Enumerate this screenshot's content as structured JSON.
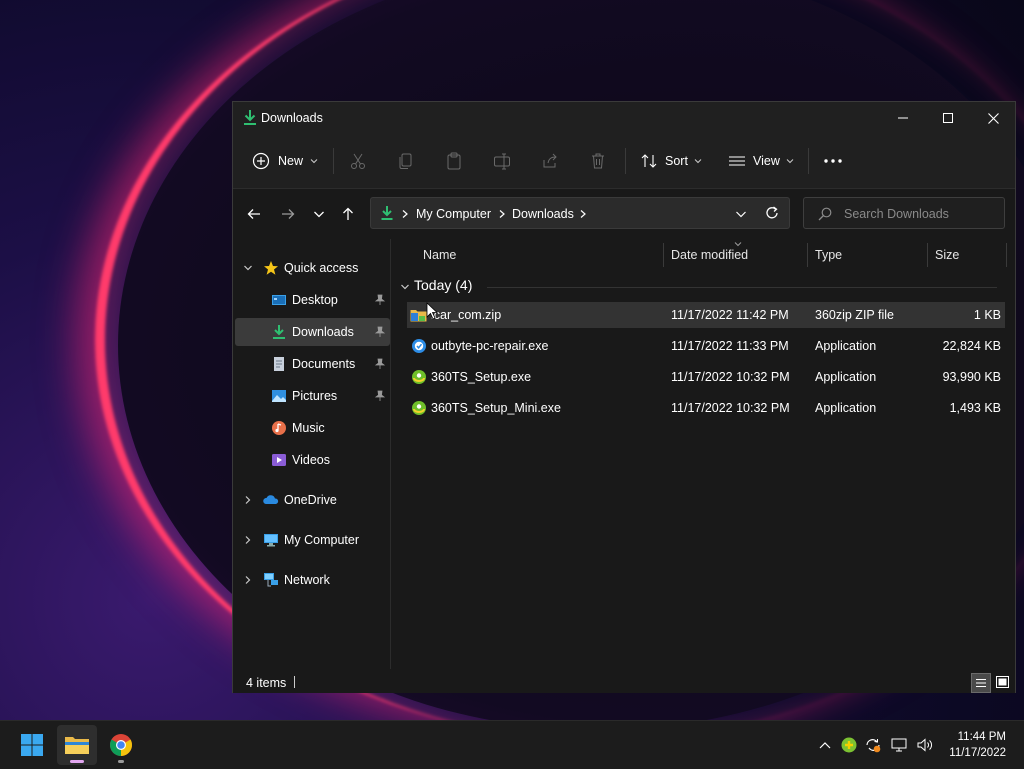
{
  "window": {
    "title": "Downloads"
  },
  "toolbar": {
    "new_label": "New",
    "sort_label": "Sort",
    "view_label": "View"
  },
  "address": {
    "segments": [
      "My Computer",
      "Downloads"
    ],
    "search_placeholder": "Search Downloads"
  },
  "sidebar": {
    "quick_access": "Quick access",
    "items": [
      {
        "label": "Desktop",
        "icon": "desktop-icon",
        "pinned": true
      },
      {
        "label": "Downloads",
        "icon": "download-icon",
        "pinned": true,
        "selected": true
      },
      {
        "label": "Documents",
        "icon": "documents-icon",
        "pinned": true
      },
      {
        "label": "Pictures",
        "icon": "pictures-icon",
        "pinned": true
      },
      {
        "label": "Music",
        "icon": "music-icon",
        "pinned": false
      },
      {
        "label": "Videos",
        "icon": "videos-icon",
        "pinned": false
      }
    ],
    "roots": [
      {
        "label": "OneDrive",
        "icon": "onedrive-icon"
      },
      {
        "label": "My Computer",
        "icon": "computer-icon"
      },
      {
        "label": "Network",
        "icon": "network-icon"
      }
    ]
  },
  "columns": {
    "name": "Name",
    "date": "Date modified",
    "type": "Type",
    "size": "Size"
  },
  "group": {
    "label": "Today (4)"
  },
  "files": [
    {
      "name": "icar_com.zip",
      "date": "11/17/2022 11:42 PM",
      "type": "360zip ZIP file",
      "size": "1 KB",
      "icon": "zip-folder-icon",
      "selected": true
    },
    {
      "name": "outbyte-pc-repair.exe",
      "date": "11/17/2022 11:33 PM",
      "type": "Application",
      "size": "22,824 KB",
      "icon": "outbyte-icon"
    },
    {
      "name": "360TS_Setup.exe",
      "date": "11/17/2022 10:32 PM",
      "type": "Application",
      "size": "93,990 KB",
      "icon": "360-icon"
    },
    {
      "name": "360TS_Setup_Mini.exe",
      "date": "11/17/2022 10:32 PM",
      "type": "Application",
      "size": "1,493 KB",
      "icon": "360-icon"
    }
  ],
  "status": {
    "items_count": "4 items"
  },
  "taskbar": {
    "time": "11:44 PM",
    "date": "11/17/2022"
  },
  "colors": {
    "accent_green": "#2fbf71",
    "selection": "#333333",
    "window_bg": "#191919"
  }
}
